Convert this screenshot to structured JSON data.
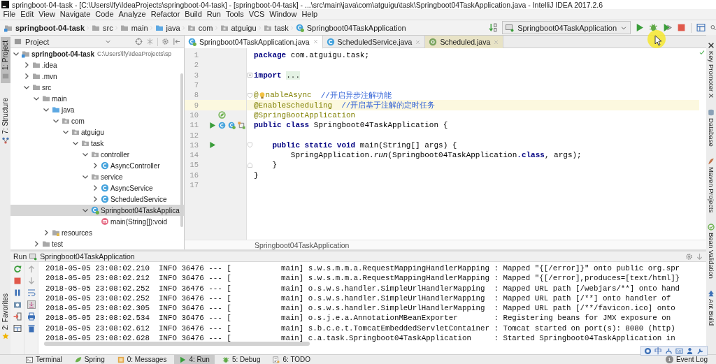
{
  "window": {
    "title": "springboot-04-task - [C:\\Users\\lfy\\IdeaProjects\\springboot-04-task] - [springboot-04-task] - ...\\src\\main\\java\\com\\atguigu\\task\\Springboot04TaskApplication.java - IntelliJ IDEA 2017.2.6"
  },
  "menu": [
    "File",
    "Edit",
    "View",
    "Navigate",
    "Code",
    "Analyze",
    "Refactor",
    "Build",
    "Run",
    "Tools",
    "VCS",
    "Window",
    "Help"
  ],
  "breadcrumbs": [
    {
      "label": "springboot-04-task",
      "kind": "module"
    },
    {
      "label": "src",
      "kind": "folder"
    },
    {
      "label": "main",
      "kind": "folder"
    },
    {
      "label": "java",
      "kind": "source"
    },
    {
      "label": "com",
      "kind": "package"
    },
    {
      "label": "atguigu",
      "kind": "package"
    },
    {
      "label": "task",
      "kind": "package"
    },
    {
      "label": "Springboot04TaskApplication",
      "kind": "spring-class"
    }
  ],
  "run_configuration": {
    "label": "Springboot04TaskApplication"
  },
  "left_stripe": [
    {
      "label": "1: Project",
      "kind": "project",
      "selected": true
    },
    {
      "label": "7: Structure",
      "kind": "structure",
      "selected": false
    },
    {
      "label": "2: Favorites",
      "kind": "favorites",
      "selected": false
    }
  ],
  "project": {
    "title": "Project",
    "tree": [
      {
        "label": "springboot-04-task",
        "kind": "module",
        "path": "C:\\Users\\lfy\\IdeaProjects\\sp",
        "expanded": true,
        "selected": false,
        "children": [
          {
            "label": ".idea",
            "kind": "folder",
            "expanded": false,
            "selected": false
          },
          {
            "label": ".mvn",
            "kind": "folder",
            "expanded": false,
            "selected": false
          },
          {
            "label": "src",
            "kind": "folder",
            "expanded": true,
            "selected": false,
            "children": [
              {
                "label": "main",
                "kind": "folder",
                "expanded": true,
                "selected": false,
                "children": [
                  {
                    "label": "java",
                    "kind": "source",
                    "expanded": true,
                    "selected": false,
                    "children": [
                      {
                        "label": "com",
                        "kind": "package",
                        "expanded": true,
                        "selected": false,
                        "children": [
                          {
                            "label": "atguigu",
                            "kind": "package",
                            "expanded": true,
                            "selected": false,
                            "children": [
                              {
                                "label": "task",
                                "kind": "package",
                                "expanded": true,
                                "selected": false,
                                "children": [
                                  {
                                    "label": "controller",
                                    "kind": "package",
                                    "expanded": true,
                                    "selected": false,
                                    "children": [
                                      {
                                        "label": "AsyncController",
                                        "kind": "class",
                                        "expanded": false,
                                        "selected": false
                                      }
                                    ]
                                  },
                                  {
                                    "label": "service",
                                    "kind": "package",
                                    "expanded": true,
                                    "selected": false,
                                    "children": [
                                      {
                                        "label": "AsyncService",
                                        "kind": "class",
                                        "expanded": false,
                                        "selected": false
                                      },
                                      {
                                        "label": "ScheduledService",
                                        "kind": "class",
                                        "expanded": false,
                                        "selected": false
                                      }
                                    ]
                                  },
                                  {
                                    "label": "Springboot04TaskApplica",
                                    "kind": "spring-class",
                                    "expanded": true,
                                    "selected": true,
                                    "children": [
                                      {
                                        "label": "main(String[]):void",
                                        "kind": "method",
                                        "selected": false
                                      }
                                    ]
                                  }
                                ]
                              }
                            ]
                          }
                        ]
                      }
                    ]
                  },
                  {
                    "label": "resources",
                    "kind": "resources",
                    "expanded": false,
                    "selected": false
                  }
                ]
              },
              {
                "label": "test",
                "kind": "folder",
                "expanded": false,
                "selected": false
              }
            ]
          }
        ]
      }
    ]
  },
  "editor": {
    "tabs": [
      {
        "label": "Springboot04TaskApplication.java",
        "kind": "spring-class",
        "selected": true,
        "library": false
      },
      {
        "label": "ScheduledService.java",
        "kind": "class",
        "selected": false,
        "library": false
      },
      {
        "label": "Scheduled.java",
        "kind": "annotation",
        "selected": false,
        "library": true
      }
    ],
    "lines": [
      {
        "number": "1",
        "current": false,
        "segments": [
          {
            "text": "package",
            "kind": "keyword"
          },
          {
            "text": " com.atguigu.task;",
            "kind": "plain"
          }
        ]
      },
      {
        "number": "2",
        "current": false
      },
      {
        "number": "3",
        "current": false,
        "fold": {
          "kind": "collapsed"
        },
        "segments": [
          {
            "text": "import",
            "kind": "keyword"
          },
          {
            "text": "...",
            "kind": "folded"
          }
        ]
      },
      {
        "number": "7",
        "current": false
      },
      {
        "number": "8",
        "current": false,
        "fold": {
          "kind": "start"
        },
        "segments": [
          {
            "text": "@",
            "kind": "annotation"
          },
          {
            "kind": "bulb"
          },
          {
            "text": "nableAsync",
            "kind": "annotation"
          },
          {
            "text": "//开启异步注解功能",
            "kind": "comment"
          }
        ]
      },
      {
        "number": "9",
        "current": true,
        "segments": [
          {
            "text": "@EnableScheduling",
            "kind": "annotation"
          },
          {
            "text": "//开启基于注解的定时任务",
            "kind": "comment"
          }
        ]
      },
      {
        "number": "10",
        "current": false,
        "gutter": [
          {
            "kind": "bean"
          }
        ],
        "segments": [
          {
            "text": "@SpringBootApplication",
            "kind": "annotation"
          }
        ]
      },
      {
        "number": "11",
        "current": false,
        "gutter": [
          {
            "kind": "run"
          },
          {
            "kind": "class"
          },
          {
            "kind": "spring-class"
          },
          {
            "kind": "bean-graph"
          }
        ],
        "segments": [
          {
            "text": "public class",
            "kind": "keyword"
          },
          {
            "text": " Springboot04TaskApplication {",
            "kind": "plain"
          }
        ]
      },
      {
        "number": "12",
        "current": false
      },
      {
        "number": "13",
        "current": false,
        "fold": {
          "kind": "start"
        },
        "gutter": [
          {
            "kind": "run"
          }
        ],
        "segments": [
          {
            "text": "    public static void",
            "kind": "keyword"
          },
          {
            "text": " main(String[] args) {",
            "kind": "plain"
          }
        ]
      },
      {
        "number": "14",
        "current": false,
        "segments": [
          {
            "text": "        SpringApplication.",
            "kind": "plain"
          },
          {
            "text": "run",
            "kind": "static-call"
          },
          {
            "text": "(Springboot04TaskApplication",
            "kind": "plain"
          },
          {
            "text": ".class",
            "kind": "keyword"
          },
          {
            "text": ", args);",
            "kind": "plain"
          }
        ]
      },
      {
        "number": "15",
        "current": false,
        "fold": {
          "kind": "end"
        },
        "segments": [
          {
            "text": "    }",
            "kind": "plain"
          }
        ]
      },
      {
        "number": "16",
        "current": false,
        "segments": [
          {
            "text": "}",
            "kind": "plain"
          }
        ]
      },
      {
        "number": "17",
        "current": false
      }
    ],
    "breadcrumb": "Springboot04TaskApplication"
  },
  "right_stripe": [
    {
      "label": "Key Promoter X",
      "kind": "key-promoter"
    },
    {
      "label": "Database",
      "kind": "database"
    },
    {
      "label": "Maven Projects",
      "kind": "maven"
    },
    {
      "label": "Bean Validation",
      "kind": "bean-validation"
    },
    {
      "label": "Ant Build",
      "kind": "ant"
    }
  ],
  "run": {
    "title": "Run",
    "configuration": "Springboot04TaskApplication",
    "log": [
      "2018-05-05 23:08:02.210  INFO 36476 --- [           main] s.w.s.m.m.a.RequestMappingHandlerMapping : Mapped \"{[/error]}\" onto public org.spr",
      "2018-05-05 23:08:02.212  INFO 36476 --- [           main] s.w.s.m.m.a.RequestMappingHandlerMapping : Mapped \"{[/error],produces=[text/html]}",
      "2018-05-05 23:08:02.252  INFO 36476 --- [           main] o.s.w.s.handler.SimpleUrlHandlerMapping  : Mapped URL path [/webjars/**] onto hand",
      "2018-05-05 23:08:02.252  INFO 36476 --- [           main] o.s.w.s.handler.SimpleUrlHandlerMapping  : Mapped URL path [/**] onto handler of",
      "2018-05-05 23:08:02.305  INFO 36476 --- [           main] o.s.w.s.handler.SimpleUrlHandlerMapping  : Mapped URL path [/**/favicon.ico] onto",
      "2018-05-05 23:08:02.534  INFO 36476 --- [           main] o.s.j.e.a.AnnotationMBeanExporter        : Registering beans for JMX exposure on",
      "2018-05-05 23:08:02.612  INFO 36476 --- [           main] s.b.c.e.t.TomcatEmbeddedServletContainer : Tomcat started on port(s): 8080 (http)",
      "2018-05-05 23:08:02.628  INFO 36476 --- [           main] c.a.task.Springboot04TaskApplication     : Started Springboot04TaskApplication in"
    ]
  },
  "bottom_tabs": [
    {
      "label": "Terminal",
      "kind": "terminal",
      "selected": false
    },
    {
      "label": "Spring",
      "kind": "spring",
      "selected": false
    },
    {
      "label": "0: Messages",
      "kind": "messages",
      "selected": false
    },
    {
      "label": "4: Run",
      "kind": "run",
      "selected": true
    },
    {
      "label": "5: Debug",
      "kind": "debug",
      "selected": false
    },
    {
      "label": "6: TODO",
      "kind": "todo",
      "selected": false
    }
  ],
  "event_log": {
    "label": "Event Log",
    "count": "1"
  },
  "ime_bar": {
    "mode": "中"
  }
}
